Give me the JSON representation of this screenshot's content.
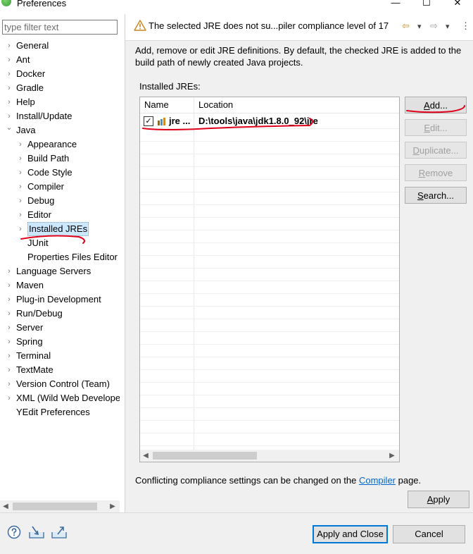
{
  "window": {
    "title": "Preferences",
    "minimize": "—",
    "maximize": "☐",
    "close": "✕"
  },
  "filter": {
    "placeholder": "type filter text"
  },
  "tree": [
    {
      "label": "General",
      "level": 0,
      "arrow": true,
      "expanded": false
    },
    {
      "label": "Ant",
      "level": 0,
      "arrow": true,
      "expanded": false
    },
    {
      "label": "Docker",
      "level": 0,
      "arrow": true,
      "expanded": false
    },
    {
      "label": "Gradle",
      "level": 0,
      "arrow": true,
      "expanded": false
    },
    {
      "label": "Help",
      "level": 0,
      "arrow": true,
      "expanded": false
    },
    {
      "label": "Install/Update",
      "level": 0,
      "arrow": true,
      "expanded": false
    },
    {
      "label": "Java",
      "level": 0,
      "arrow": true,
      "expanded": true
    },
    {
      "label": "Appearance",
      "level": 1,
      "arrow": true,
      "expanded": false
    },
    {
      "label": "Build Path",
      "level": 1,
      "arrow": true,
      "expanded": false
    },
    {
      "label": "Code Style",
      "level": 1,
      "arrow": true,
      "expanded": false
    },
    {
      "label": "Compiler",
      "level": 1,
      "arrow": true,
      "expanded": false
    },
    {
      "label": "Debug",
      "level": 1,
      "arrow": true,
      "expanded": false
    },
    {
      "label": "Editor",
      "level": 1,
      "arrow": true,
      "expanded": false
    },
    {
      "label": "Installed JREs",
      "level": 1,
      "arrow": true,
      "expanded": false,
      "selected": true
    },
    {
      "label": "JUnit",
      "level": 1,
      "arrow": false,
      "expanded": false
    },
    {
      "label": "Properties Files Editor",
      "level": 1,
      "arrow": false,
      "expanded": false
    },
    {
      "label": "Language Servers",
      "level": 0,
      "arrow": true,
      "expanded": false
    },
    {
      "label": "Maven",
      "level": 0,
      "arrow": true,
      "expanded": false
    },
    {
      "label": "Plug-in Development",
      "level": 0,
      "arrow": true,
      "expanded": false
    },
    {
      "label": "Run/Debug",
      "level": 0,
      "arrow": true,
      "expanded": false
    },
    {
      "label": "Server",
      "level": 0,
      "arrow": true,
      "expanded": false
    },
    {
      "label": "Spring",
      "level": 0,
      "arrow": true,
      "expanded": false
    },
    {
      "label": "Terminal",
      "level": 0,
      "arrow": true,
      "expanded": false
    },
    {
      "label": "TextMate",
      "level": 0,
      "arrow": true,
      "expanded": false
    },
    {
      "label": "Version Control (Team)",
      "level": 0,
      "arrow": true,
      "expanded": false
    },
    {
      "label": "XML (Wild Web Developer)",
      "level": 0,
      "arrow": true,
      "expanded": false
    },
    {
      "label": "YEdit Preferences",
      "level": 0,
      "arrow": false,
      "expanded": false
    }
  ],
  "message": {
    "text": "The selected JRE does not su...piler compliance level of 17",
    "icon": "warning-icon"
  },
  "nav": {
    "back": "⇦",
    "back_menu": "▾",
    "forward": "⇨",
    "forward_menu": "▾",
    "more": "⋮"
  },
  "description": "Add, remove or edit JRE definitions. By default, the checked JRE is added to the build path of newly created Java projects.",
  "installed_label": "Installed JREs:",
  "table": {
    "columns": [
      "Name",
      "Location"
    ],
    "rows": [
      {
        "name": "jre ...",
        "location": "D:\\tools\\java\\jdk1.8.0_92\\jre",
        "checked": true
      }
    ]
  },
  "buttons": {
    "add": "Add...",
    "edit": "Edit...",
    "duplicate": "Duplicate...",
    "remove": "Remove",
    "search": "Search...",
    "apply": "Apply",
    "apply_close": "Apply and Close",
    "cancel": "Cancel"
  },
  "conflict": {
    "before": "Conflicting compliance settings can be changed on the ",
    "link": "Compiler",
    "after": " page."
  },
  "colors": {
    "accent": "#0078d7",
    "link": "#0066cc",
    "annotation": "#e0001a"
  }
}
